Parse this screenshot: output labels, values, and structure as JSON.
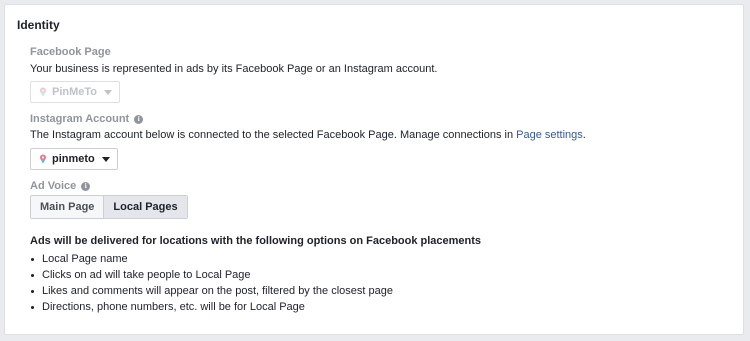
{
  "section": {
    "title": "Identity"
  },
  "facebook_page": {
    "label": "Facebook Page",
    "description": "Your business is represented in ads by its Facebook Page or an Instagram account.",
    "selected": "PinMeTo",
    "icon": "pin-icon"
  },
  "instagram_account": {
    "label": "Instagram Account",
    "info_icon": "i",
    "description_prefix": "The Instagram account below is connected to the selected Facebook Page. Manage connections in ",
    "description_link": "Page settings",
    "description_suffix": ".",
    "selected": "pinmeto",
    "icon": "pin-icon"
  },
  "ad_voice": {
    "label": "Ad Voice",
    "info_icon": "i",
    "options": [
      "Main Page",
      "Local Pages"
    ],
    "selected": "Local Pages"
  },
  "delivery": {
    "heading": "Ads will be delivered for locations with the following options on Facebook placements",
    "bullets": [
      "Local Page name",
      "Clicks on ad will take people to Local Page",
      "Likes and comments will appear on the post, filtered by the closest page",
      "Directions, phone numbers, etc. will be for Local Page"
    ]
  },
  "colors": {
    "link": "#365899",
    "muted": "#90949c",
    "text": "#1d2129",
    "active_segment": "#e4e6eb"
  }
}
